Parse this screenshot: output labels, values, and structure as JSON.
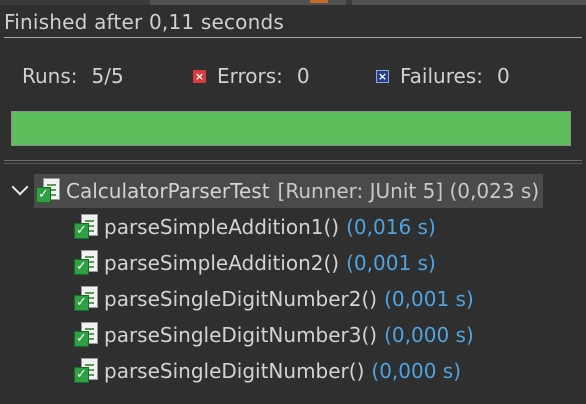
{
  "status": {
    "text": "Finished after 0,11 seconds"
  },
  "counters": {
    "runs_label": "Runs:",
    "runs_value": "5/5",
    "errors_label": "Errors:",
    "errors_value": "0",
    "failures_label": "Failures:",
    "failures_value": "0"
  },
  "progress": {
    "fraction": 1.0,
    "color": "#5cbf5c"
  },
  "tree": {
    "root": {
      "name": "CalculatorParserTest",
      "meta": "[Runner: JUnit 5] (0,023 s)"
    },
    "tests": [
      {
        "name": "parseSimpleAddition1()",
        "time": "(0,016 s)"
      },
      {
        "name": "parseSimpleAddition2()",
        "time": "(0,001 s)"
      },
      {
        "name": "parseSingleDigitNumber2()",
        "time": "(0,001 s)"
      },
      {
        "name": "parseSingleDigitNumber3()",
        "time": "(0,000 s)"
      },
      {
        "name": "parseSingleDigitNumber()",
        "time": "(0,000 s)"
      }
    ]
  },
  "icons": {
    "error": "error-icon",
    "failure": "failure-icon",
    "suite": "test-suite-ok-icon",
    "test": "test-ok-icon",
    "expand": "chevron-down-icon"
  },
  "colors": {
    "background": "#2f2f2f",
    "time_text": "#4fa3e0",
    "error": "#d83b3b",
    "failure": "#23408e",
    "pass": "#2ea043"
  }
}
